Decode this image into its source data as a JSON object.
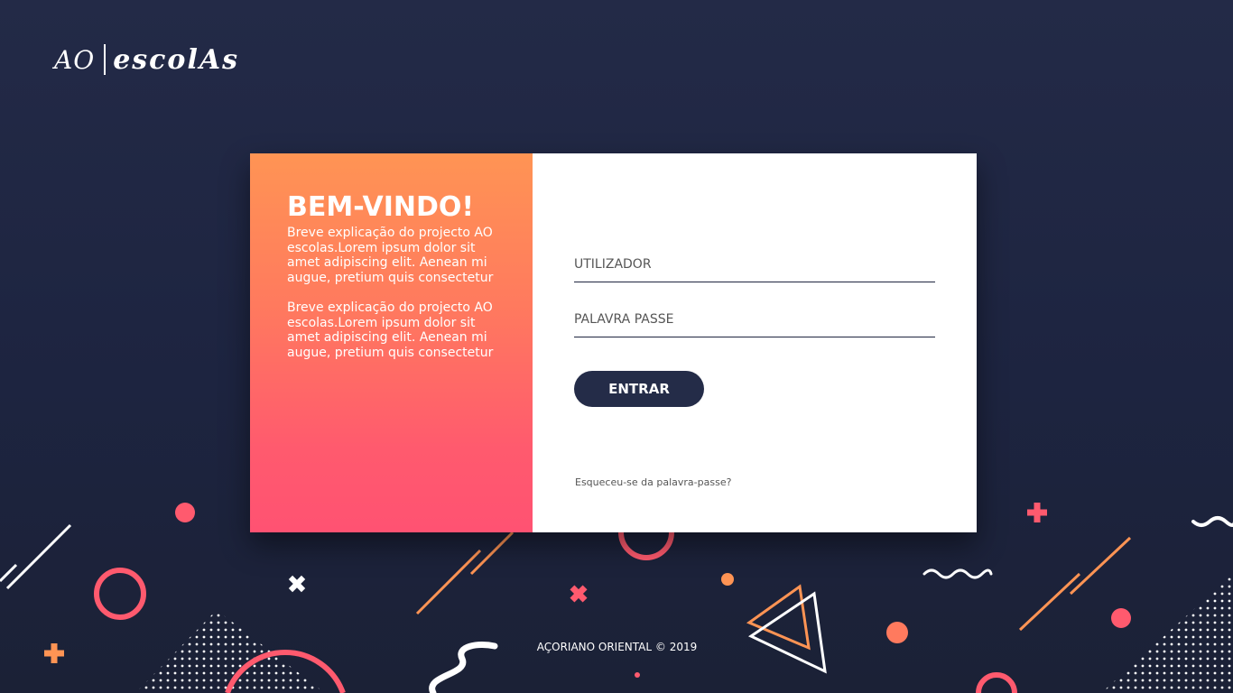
{
  "logo": {
    "left_text": "AO",
    "right_text": "escolAs"
  },
  "welcome": {
    "title": "BEM-VINDO!",
    "paragraphs": [
      "Breve explicação do projecto AO escolas.Lorem ipsum dolor sit amet adipiscing elit. Aenean mi augue, pretium quis consectetur",
      "Breve explicação do projecto AO escolas.Lorem ipsum dolor sit amet adipiscing elit. Aenean mi augue, pretium quis consectetur"
    ]
  },
  "form": {
    "username_placeholder": "UTILIZADOR",
    "password_placeholder": "PALAVRA PASSE",
    "submit_label": "ENTRAR",
    "forgot_label": "Esqueceu-se da palavra-passe?"
  },
  "footer": {
    "text": "AÇORIANO ORIENTAL © 2019"
  },
  "colors": {
    "background": "#1f2640",
    "accent_orange": "#ff9454",
    "accent_pink": "#ff5272",
    "button": "#242c48",
    "white": "#ffffff"
  }
}
